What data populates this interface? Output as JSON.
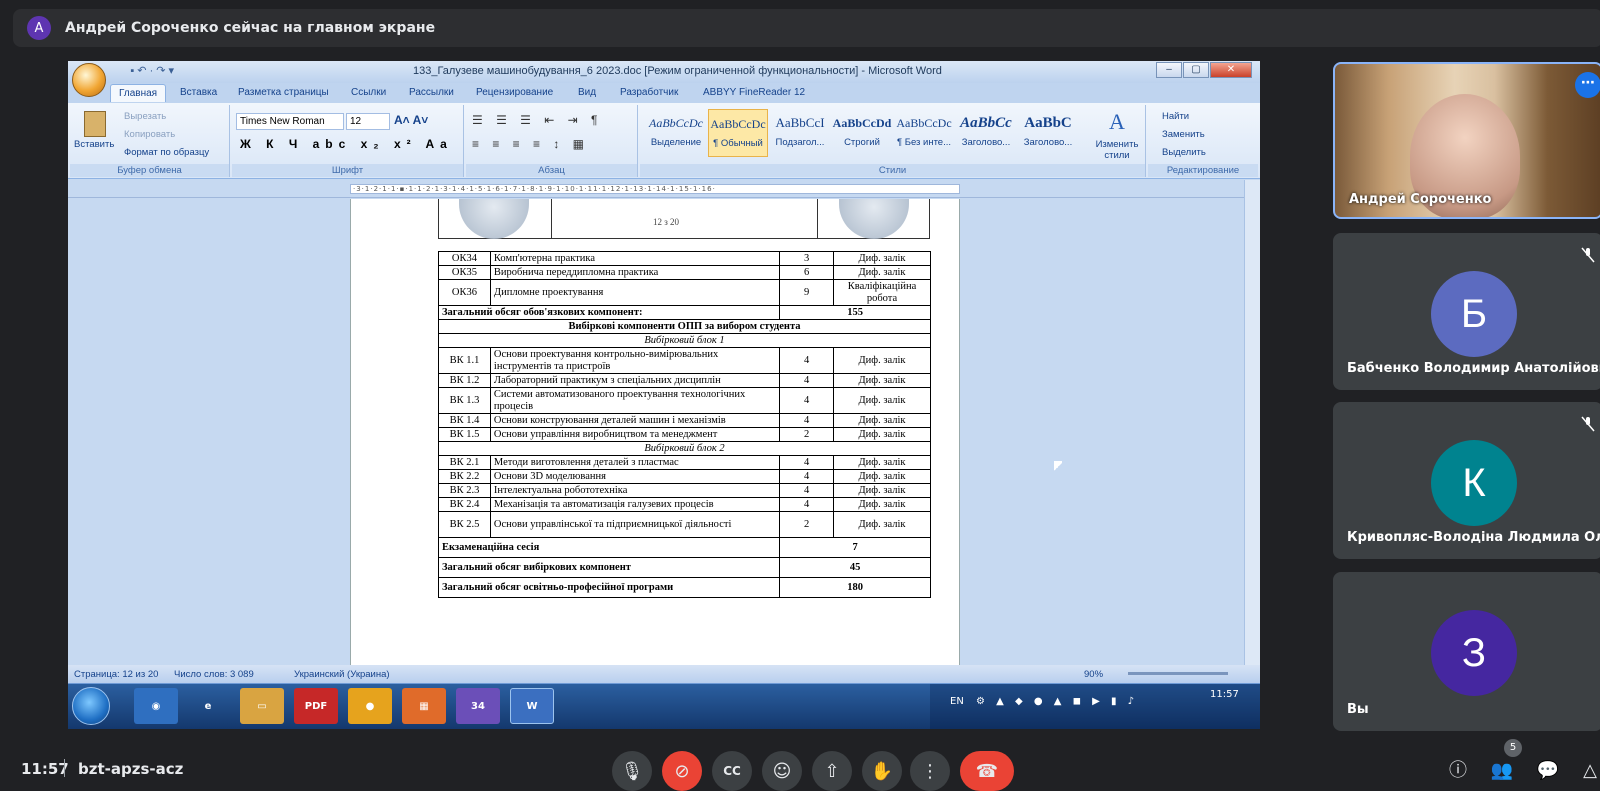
{
  "banner": {
    "avatar": "А",
    "text": "Андрей Сороченко сейчас на главном экране"
  },
  "word": {
    "title": "133_Галузеве машинобудування_6 2023.doc [Режим ограниченной функциональности] - Microsoft Word",
    "tabs": [
      "Главная",
      "Вставка",
      "Разметка страницы",
      "Ссылки",
      "Рассылки",
      "Рецензирование",
      "Вид",
      "Разработчик",
      "ABBYY FineReader 12"
    ],
    "clipboard": {
      "paste": "Вставить",
      "cut": "Вырезать",
      "copy": "Копировать",
      "format": "Формат по образцу",
      "label": "Буфер обмена"
    },
    "font": {
      "name": "Times New Roman",
      "size": "12",
      "label": "Шрифт"
    },
    "paragraph_label": "Абзац",
    "styles": [
      {
        "sample": "AaBbCcDc",
        "name": "Выделение"
      },
      {
        "sample": "AaBbCcDc",
        "name": "¶ Обычный"
      },
      {
        "sample": "AaBbCcI",
        "name": "Подзагол..."
      },
      {
        "sample": "AaBbCcDd",
        "name": "Строгий"
      },
      {
        "sample": "AaBbCcDc",
        "name": "¶ Без инте..."
      },
      {
        "sample": "AaBbCc",
        "name": "Заголово..."
      },
      {
        "sample": "AaBbC",
        "name": "Заголово..."
      }
    ],
    "styles_label": "Стили",
    "change_styles": "Изменить стили",
    "editing": {
      "find": "Найти",
      "replace": "Заменить",
      "select": "Выделить",
      "label": "Редактирование"
    },
    "header_page": "12 з 20",
    "table_rows": [
      {
        "code": "ОК34",
        "name": "Комп'ютерна практика",
        "credits": "3",
        "form": "Диф. залік"
      },
      {
        "code": "ОК35",
        "name": "Виробнича переддипломна практика",
        "credits": "6",
        "form": "Диф. залік"
      },
      {
        "code": "ОК36",
        "name": "Дипломне проектування",
        "credits": "9",
        "form": "Кваліфікаційна робота"
      }
    ],
    "total_mandatory": {
      "label": "Загальний обсяг обов'язкових компонент:",
      "value": "155"
    },
    "elective_title": "Вибіркові компоненти ОПП за вибором студента",
    "block1": "Вибірковий блок 1",
    "block1_rows": [
      {
        "code": "ВК 1.1",
        "name": "Основи проектування контрольно-вимірювальних інструментів та пристроїв",
        "credits": "4",
        "form": "Диф. залік"
      },
      {
        "code": "ВК 1.2",
        "name": "Лабораторний практикум з спеціальних дисциплін",
        "credits": "4",
        "form": "Диф. залік"
      },
      {
        "code": "ВК 1.3",
        "name": "Системи автоматизованого проектування технологічних процесів",
        "credits": "4",
        "form": "Диф. залік"
      },
      {
        "code": "ВК 1.4",
        "name": "Основи конструювання деталей машин і механізмів",
        "credits": "4",
        "form": "Диф. залік"
      },
      {
        "code": "ВК 1.5",
        "name": "Основи управління виробництвом та менеджмент",
        "credits": "2",
        "form": "Диф. залік"
      }
    ],
    "block2": "Вибірковий блок 2",
    "block2_rows": [
      {
        "code": "ВК 2.1",
        "name": "Методи виготовлення деталей з пластмас",
        "credits": "4",
        "form": "Диф. залік"
      },
      {
        "code": "ВК 2.2",
        "name": "Основи 3D моделювання",
        "credits": "4",
        "form": "Диф. залік"
      },
      {
        "code": "ВК 2.3",
        "name": "Інтелектуальна робототехніка",
        "credits": "4",
        "form": "Диф. залік"
      },
      {
        "code": "ВК 2.4",
        "name": "Механізація та автоматизація галузевих процесів",
        "credits": "4",
        "form": "Диф. залік"
      },
      {
        "code": "ВК 2.5",
        "name": "Основи управлінської та підприємницької діяльності",
        "credits": "2",
        "form": "Диф. залік"
      }
    ],
    "exam": {
      "label": "Екзаменаційна сесія",
      "value": "7"
    },
    "total_elective": {
      "label": "Загальний обсяг вибіркових компонент",
      "value": "45"
    },
    "total_program": {
      "label": "Загальний обсяг освітньо-професійної програми",
      "value": "180"
    },
    "status": {
      "page": "Страница: 12 из 20",
      "words": "Число слов: 3 089",
      "lang": "Украинский (Украина)",
      "zoom": "90%"
    },
    "tray": {
      "lang": "EN",
      "time": "11:57"
    },
    "taskbar_badge": "34"
  },
  "participants": [
    {
      "name": "Андрей Сороченко",
      "initial": "",
      "color": ""
    },
    {
      "name": "Бабченко Володимир Анатолійович",
      "initial": "Б",
      "color": "#5c6bc0"
    },
    {
      "name": "Кривопляс-Володіна Людмила Оле...",
      "initial": "К",
      "color": "#00838f"
    },
    {
      "name": "Вы",
      "initial": "З",
      "color": "#4527a0"
    }
  ],
  "meeting": {
    "time": "11:57",
    "code": "bzt-apzs-acz",
    "people_count": "5"
  }
}
